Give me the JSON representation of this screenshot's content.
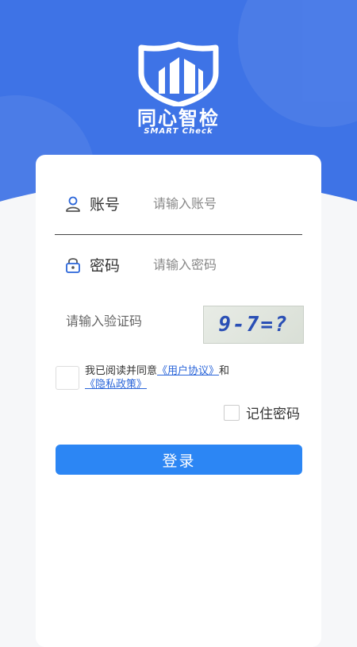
{
  "brand": {
    "name_cn": "同心智检",
    "name_en": "SMART Check"
  },
  "form": {
    "account": {
      "label": "账号",
      "placeholder": "请输入账号",
      "value": ""
    },
    "password": {
      "label": "密码",
      "placeholder": "请输入密码",
      "value": ""
    },
    "captcha": {
      "placeholder": "请输入验证码",
      "value": "",
      "image_text": "9-7=?"
    },
    "agreement": {
      "prefix": "我已阅读并同意",
      "user_agreement": "《用户协议》",
      "connector": "和",
      "privacy_policy": "《隐私政策》"
    },
    "remember_label": "记住密码",
    "login_label": "登录"
  },
  "colors": {
    "primary": "#3e73e6",
    "button": "#2c86f4",
    "link": "#2a65d9"
  }
}
